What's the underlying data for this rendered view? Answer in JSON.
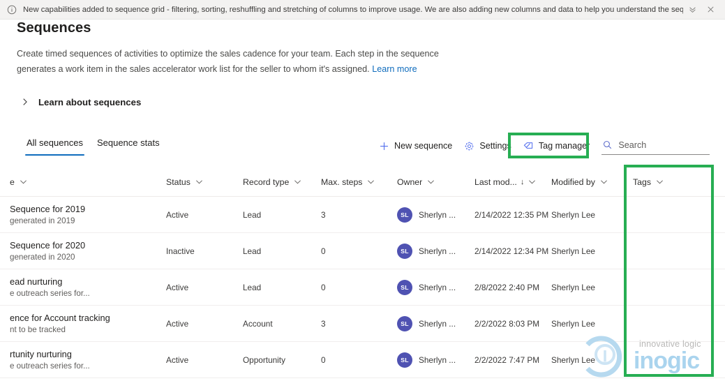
{
  "notification": {
    "icon": "info-circle-icon",
    "message": "New capabilities added to sequence grid - filtering, sorting, reshuffling and stretching of columns to improve usage. We are also adding new columns and data to help you understand the sequenc...",
    "expand_icon": "double-chevron-down-icon",
    "close_icon": "close-icon",
    "background": "#f3f2f1"
  },
  "page": {
    "title": "Sequences",
    "description": "Create timed sequences of activities to optimize the sales cadence for your team. Each step in the sequence generates a work item in the sales accelerator work list for the seller to whom it's assigned.",
    "learn_more_label": "Learn more",
    "collapsible": {
      "icon": "chevron-right-icon",
      "label": "Learn about sequences"
    }
  },
  "tabs": [
    {
      "label": "All sequences",
      "active": true
    },
    {
      "label": "Sequence stats",
      "active": false
    }
  ],
  "command_bar": {
    "items": [
      {
        "label": "New sequence",
        "icon": "plus-icon"
      },
      {
        "label": "Settings",
        "icon": "gear-icon"
      },
      {
        "label": "Tag manager",
        "icon": "tag-icon",
        "highlighted": true
      }
    ],
    "search": {
      "placeholder": "Search",
      "value": "",
      "icon": "search-icon"
    }
  },
  "grid": {
    "columns": [
      {
        "key": "name",
        "label": "e",
        "sortable": true,
        "sorted": false
      },
      {
        "key": "status",
        "label": "Status",
        "sortable": true,
        "sorted": false
      },
      {
        "key": "record_type",
        "label": "Record type",
        "sortable": true,
        "sorted": false
      },
      {
        "key": "max_steps",
        "label": "Max. steps",
        "sortable": true,
        "sorted": false
      },
      {
        "key": "owner",
        "label": "Owner",
        "sortable": true,
        "sorted": false
      },
      {
        "key": "last_modified",
        "label": "Last mod...",
        "sortable": true,
        "sorted": true,
        "sort_direction": "desc",
        "sort_glyph": "↓"
      },
      {
        "key": "modified_by",
        "label": "Modified by",
        "sortable": true,
        "sorted": false
      },
      {
        "key": "tags",
        "label": "Tags",
        "sortable": true,
        "sorted": false,
        "highlighted": true
      }
    ],
    "rows": [
      {
        "name": "Sequence for 2019",
        "subtitle": "generated in 2019",
        "status": "Active",
        "record_type": "Lead",
        "max_steps": "3",
        "owner": "Sherlyn ...",
        "owner_initials": "SL",
        "last_modified": "2/14/2022 12:35 PM",
        "modified_by": "Sherlyn Lee",
        "tags": ""
      },
      {
        "name": "Sequence for 2020",
        "subtitle": "generated in 2020",
        "status": "Inactive",
        "record_type": "Lead",
        "max_steps": "0",
        "owner": "Sherlyn ...",
        "owner_initials": "SL",
        "last_modified": "2/14/2022 12:34 PM",
        "modified_by": "Sherlyn Lee",
        "tags": ""
      },
      {
        "name": "ead nurturing",
        "subtitle": "e outreach series for...",
        "status": "Active",
        "record_type": "Lead",
        "max_steps": "0",
        "owner": "Sherlyn ...",
        "owner_initials": "SL",
        "last_modified": "2/8/2022 2:40 PM",
        "modified_by": "Sherlyn Lee",
        "tags": ""
      },
      {
        "name": "ence for Account tracking",
        "subtitle": "nt to be tracked",
        "status": "Active",
        "record_type": "Account",
        "max_steps": "3",
        "owner": "Sherlyn ...",
        "owner_initials": "SL",
        "last_modified": "2/2/2022 8:03 PM",
        "modified_by": "Sherlyn Lee",
        "tags": ""
      },
      {
        "name": "rtunity nurturing",
        "subtitle": "e outreach series for...",
        "status": "Active",
        "record_type": "Opportunity",
        "max_steps": "0",
        "owner": "Sherlyn ...",
        "owner_initials": "SL",
        "last_modified": "2/2/2022 7:47 PM",
        "modified_by": "Sherlyn Lee",
        "tags": ""
      }
    ]
  },
  "watermark": {
    "wordmark": "inogic",
    "tagline": "innovative logic"
  },
  "colors": {
    "accent": "#0f6cbd",
    "icon_accent": "#4f6bed",
    "highlight_box": "#27ae53",
    "avatar": "#4f52b2"
  }
}
